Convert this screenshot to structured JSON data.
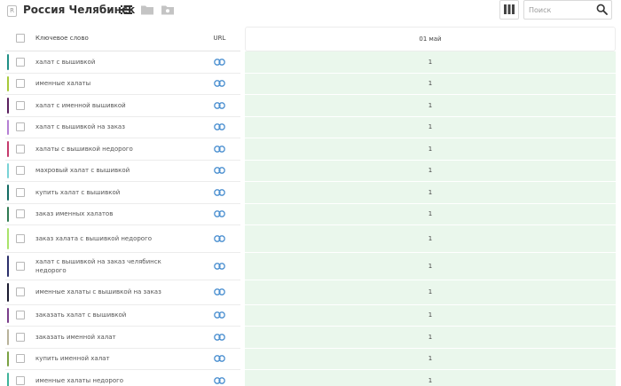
{
  "header": {
    "logo_letter": "R",
    "title": "Россия Челябинск"
  },
  "search": {
    "placeholder": "Поиск"
  },
  "table": {
    "col_keyword": "Ключевое слово",
    "col_url": "URL",
    "col_date": "01 май",
    "rows": [
      {
        "keyword": "халат с вышивкой",
        "value": "1",
        "color": "#1f8f86"
      },
      {
        "keyword": "именные халаты",
        "value": "1",
        "color": "#a6c939"
      },
      {
        "keyword": "халат с именной вышивкой",
        "value": "1",
        "color": "#5a1f5e"
      },
      {
        "keyword": "халат с вышивкой на заказ",
        "value": "1",
        "color": "#b57fd4"
      },
      {
        "keyword": "халаты с вышивкой недорого",
        "value": "1",
        "color": "#c53a6d"
      },
      {
        "keyword": "махровый халат с вышивкой",
        "value": "1",
        "color": "#79d3d6"
      },
      {
        "keyword": "купить халат с вышивкой",
        "value": "1",
        "color": "#136b63"
      },
      {
        "keyword": "заказ именных халатов",
        "value": "1",
        "color": "#2f7a52"
      },
      {
        "keyword": "заказ халата с вышивкой недорого",
        "value": "1",
        "color": "#a9e36a"
      },
      {
        "keyword": "халат с вышивкой на заказ челябинск недорого",
        "value": "1",
        "color": "#2b2f6b"
      },
      {
        "keyword": "именные халаты с вышивкой на заказ",
        "value": "1",
        "color": "#1a1a2e"
      },
      {
        "keyword": "заказать халат с вышивкой",
        "value": "1",
        "color": "#7a3d8a"
      },
      {
        "keyword": "заказать именной халат",
        "value": "1",
        "color": "#b8b29a"
      },
      {
        "keyword": "купить именной халат",
        "value": "1",
        "color": "#7aa142"
      },
      {
        "keyword": "именные халаты недорого",
        "value": "1",
        "color": "#3fb39a"
      }
    ]
  }
}
